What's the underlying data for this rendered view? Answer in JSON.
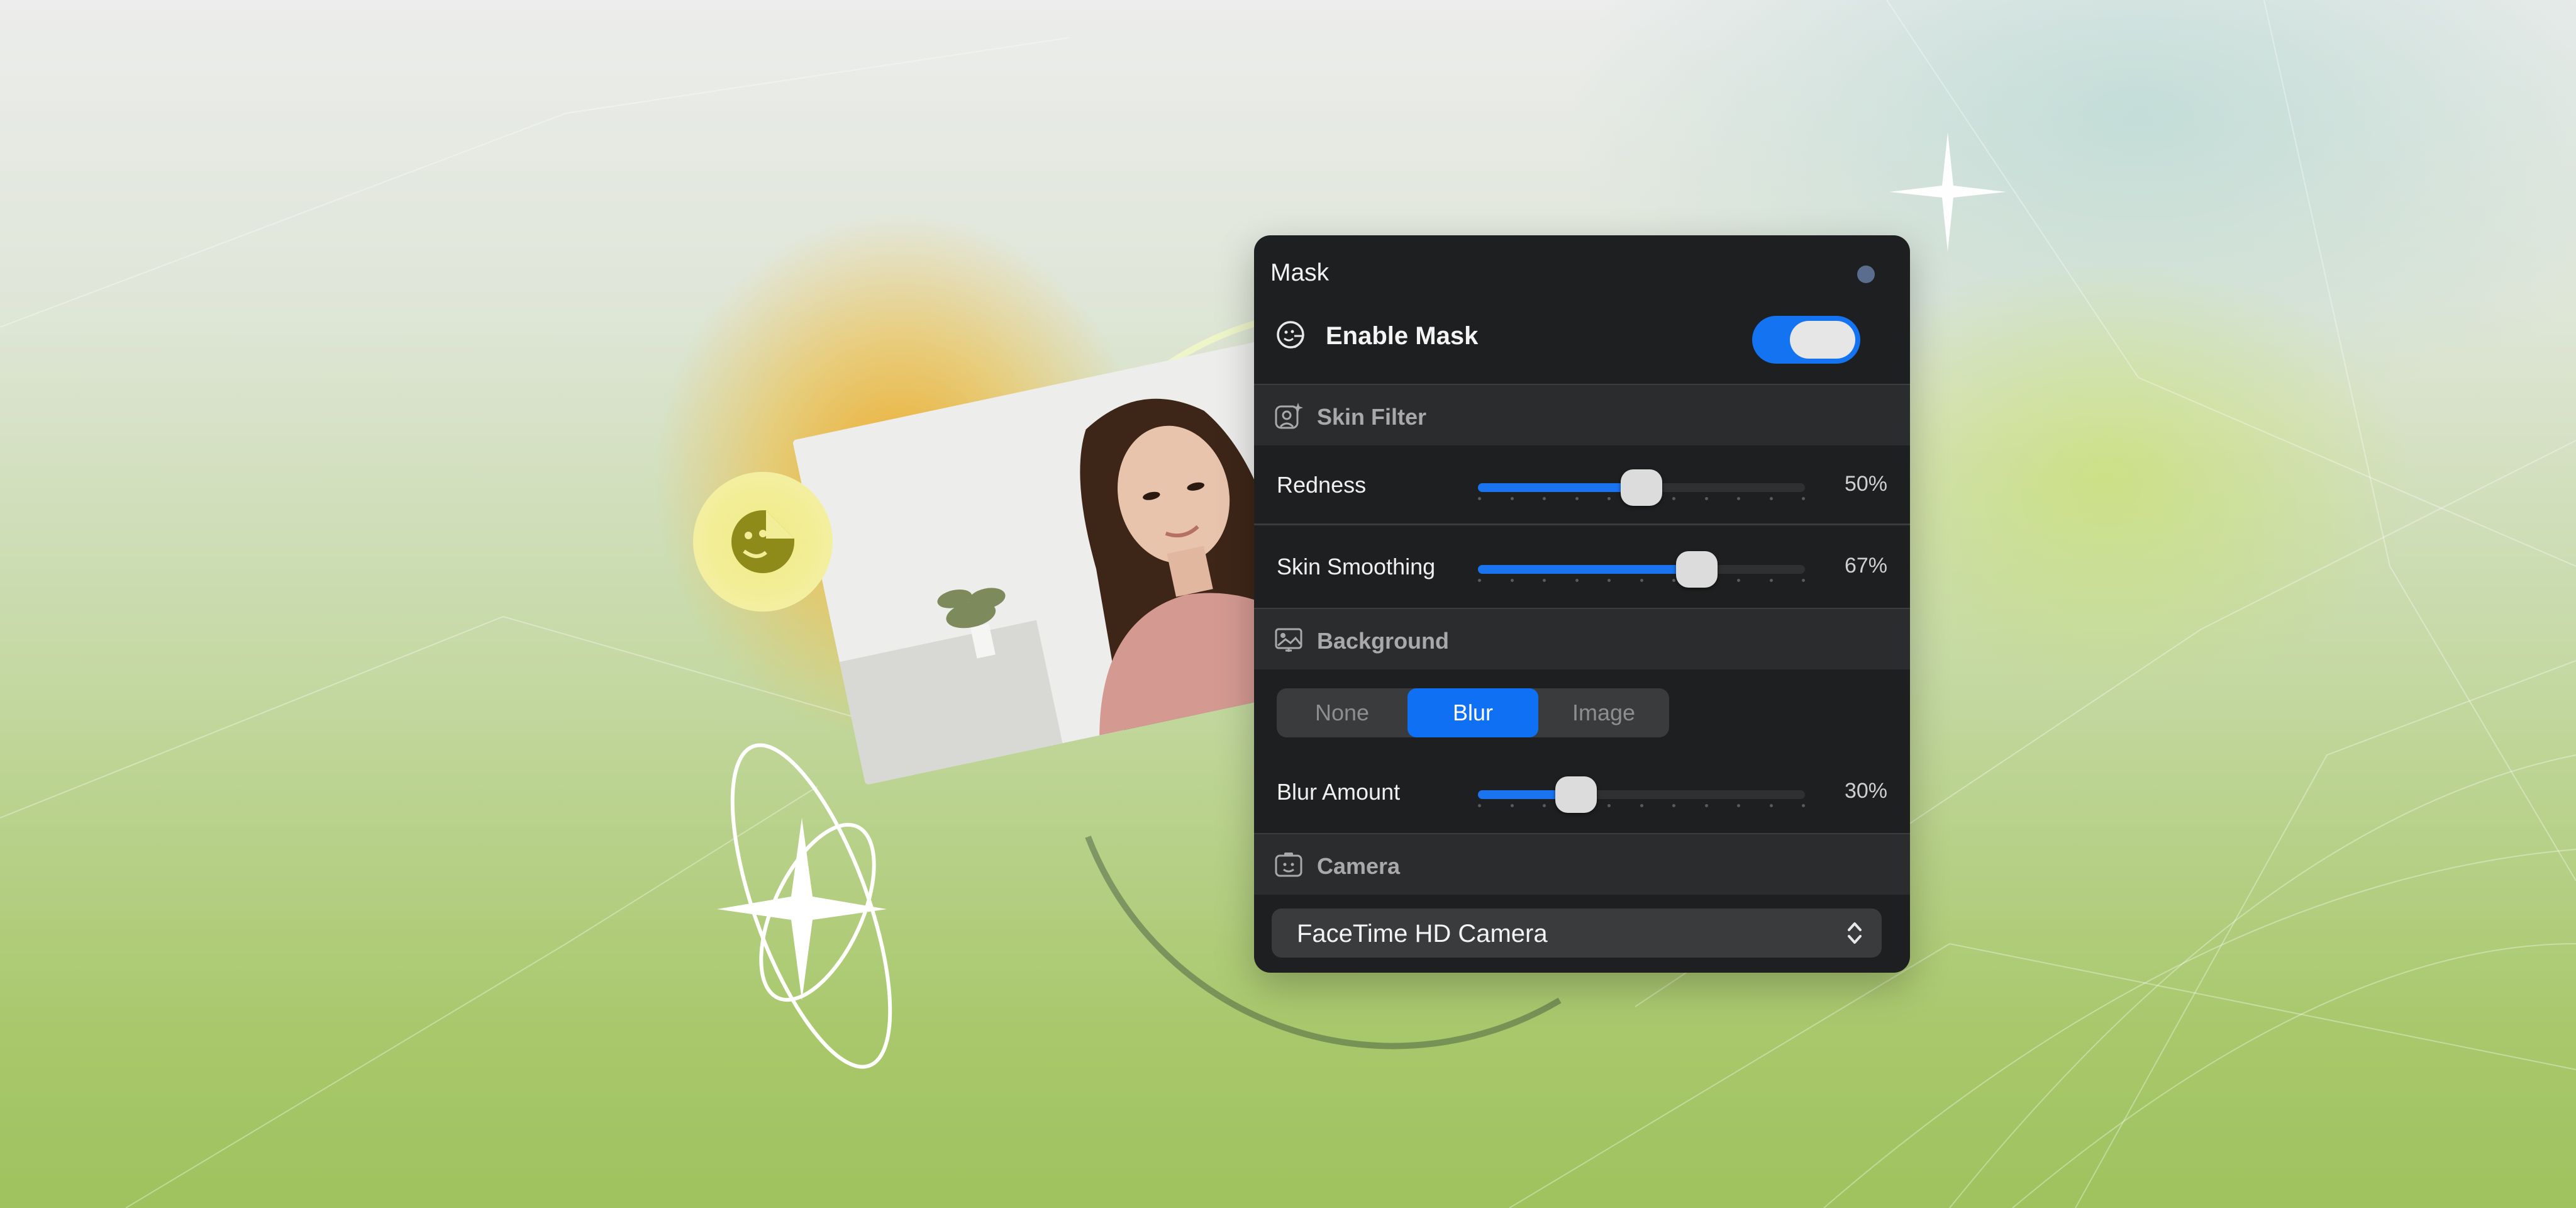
{
  "panel": {
    "title": "Mask",
    "enable": {
      "label": "Enable Mask",
      "on": true,
      "icon": "mask-face-icon"
    },
    "skin_filter": {
      "header": "Skin Filter",
      "icon": "face-sparkle-icon",
      "redness": {
        "label": "Redness",
        "value_text": "50%",
        "value": 0.5
      },
      "smoothing": {
        "label": "Skin Smoothing",
        "value_text": "67%",
        "value": 0.67
      }
    },
    "background": {
      "header": "Background",
      "icon": "background-image-icon",
      "options": [
        "None",
        "Blur",
        "Image"
      ],
      "selected": "Blur",
      "blur": {
        "label": "Blur Amount",
        "value_text": "30%",
        "value": 0.3
      }
    },
    "camera": {
      "header": "Camera",
      "icon": "camera-face-icon",
      "selected": "FaceTime HD Camera"
    }
  },
  "colors": {
    "accent": "#1473f0",
    "panel_bg": "#1e1f20",
    "section_bg": "#2b2c2e"
  }
}
